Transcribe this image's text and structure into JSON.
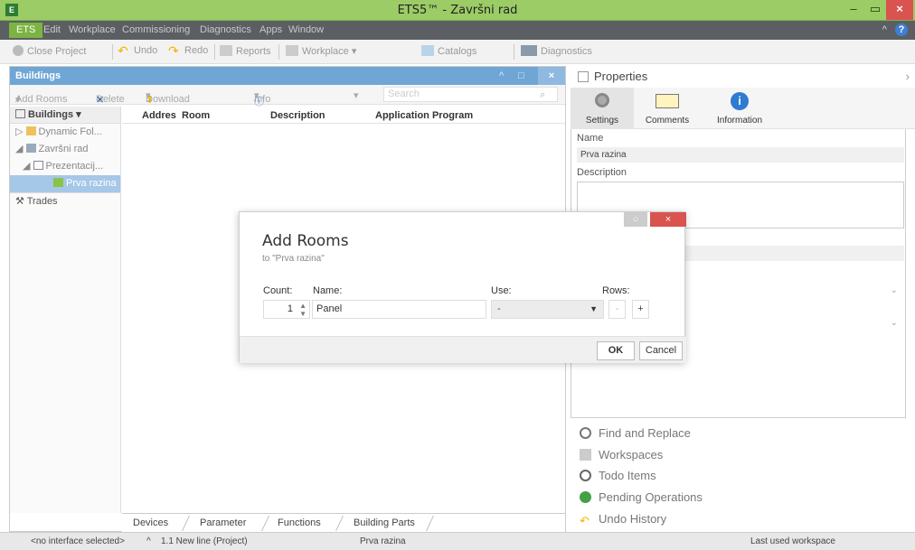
{
  "window": {
    "title": "ETS5™ - Završni rad",
    "app_icon": "ets-app-icon",
    "min": "‒",
    "max": "▭",
    "close": "×"
  },
  "menu": {
    "ets": "ETS",
    "items": [
      "Edit",
      "Workplace",
      "Commissioning",
      "Diagnostics",
      "Apps",
      "Window"
    ],
    "collapse": "^",
    "help": "?"
  },
  "toolbar": {
    "close_project": "Close Project",
    "undo": "Undo",
    "redo": "Redo",
    "reports": "Reports",
    "workplace": "Workplace ▾",
    "catalogs": "Catalogs",
    "diagnostics": "Diagnostics"
  },
  "buildings_panel": {
    "title": "Buildings",
    "tools": {
      "add_rooms": "Add Rooms",
      "delete": "Delete",
      "download": "Download",
      "info": "Info",
      "search_placeholder": "Search"
    },
    "tree_header": "Buildings",
    "tree": [
      "Dynamic Fol...",
      "Završni rad",
      "Prezentacij...",
      "Prva razina"
    ],
    "trades": "Trades",
    "columns": [
      "Addres",
      "Room",
      "Description",
      "Application Program"
    ],
    "bottom_tabs": [
      "Devices",
      "Parameter",
      "Functions",
      "Building Parts"
    ]
  },
  "properties_panel": {
    "title": "Properties",
    "tabs": [
      "Settings",
      "Comments",
      "Information"
    ],
    "name_label": "Name",
    "name_value": "Prva razina",
    "description_label": "Description",
    "links": [
      "Find and Replace",
      "Workspaces",
      "Todo Items",
      "Pending Operations",
      "Undo History"
    ]
  },
  "dialog": {
    "title": "Add Rooms",
    "subtitle": "to \"Prva razina\"",
    "count_label": "Count:",
    "name_label": "Name:",
    "use_label": "Use:",
    "rows_label": "Rows:",
    "count_value": "1",
    "name_value": "Panel",
    "use_value": "-",
    "minus": "-",
    "plus": "+",
    "ok": "OK",
    "cancel": "Cancel",
    "close": "×",
    "pin": "○"
  },
  "status": {
    "interface": "<no interface selected>",
    "line": "1.1 New line (Project)",
    "selection": "Prva razina",
    "workspace": "Last used workspace"
  },
  "colors": {
    "titlebar": "#9ccc65",
    "menubar": "#5b5f63",
    "accent_blue": "#6fa6d6",
    "close_red": "#d9534f"
  }
}
